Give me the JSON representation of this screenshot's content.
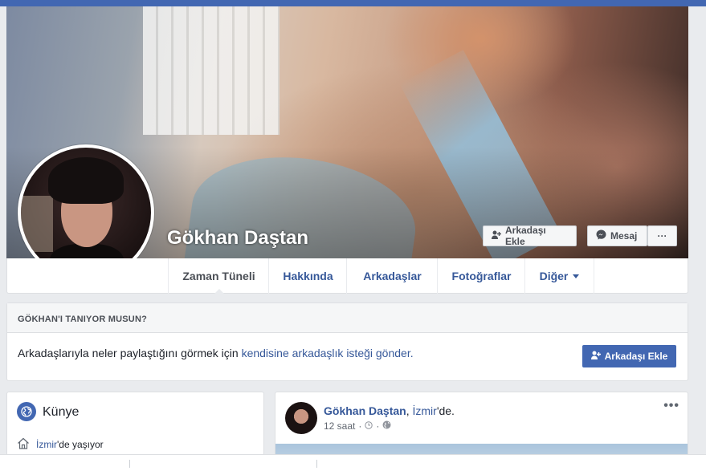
{
  "profile": {
    "name": "Gökhan Daştan"
  },
  "cover_actions": {
    "add_friend": "Arkadaşı Ekle",
    "message": "Mesaj",
    "more": "···"
  },
  "nav": {
    "tabs": [
      {
        "label": "Zaman Tüneli",
        "active": true
      },
      {
        "label": "Hakkında"
      },
      {
        "label": "Arkadaşlar"
      },
      {
        "label": "Fotoğraflar"
      },
      {
        "label": "Diğer"
      }
    ]
  },
  "know_card": {
    "heading": "GÖKHAN'I TANIYOR MUSUN?",
    "text_prefix": "Arkadaşlarıyla neler paylaştığını görmek için ",
    "text_link": "kendisine arkadaşlık isteği gönder.",
    "button": "Arkadaşı Ekle"
  },
  "intro": {
    "title": "Künye",
    "lives_city": "İzmir",
    "lives_suffix": "'de yaşıyor"
  },
  "post": {
    "author": "Gökhan Daştan",
    "location_prefix": ", ",
    "location": "İzmir",
    "location_suffix": "'de.",
    "time": "12 saat",
    "dot": "·",
    "more": "•••"
  },
  "colors": {
    "brand": "#4267b2",
    "link": "#365899",
    "background": "#e9ebee"
  }
}
